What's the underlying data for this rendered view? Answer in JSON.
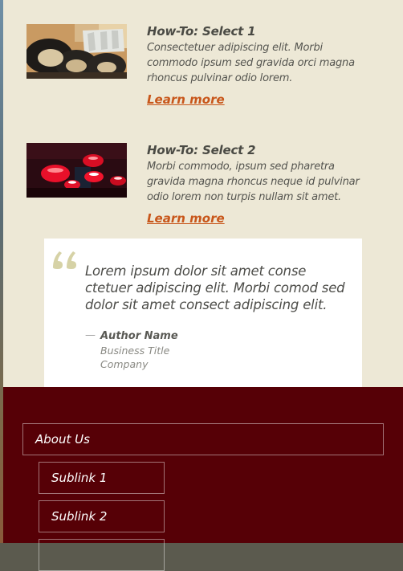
{
  "articles": [
    {
      "title": "How-To: Select 1",
      "description": "Consectetuer adipiscing elit. Morbi commodo ipsum sed gravida orci magna rhoncus pulvinar odio lorem.",
      "link_label": "Learn more"
    },
    {
      "title": "How-To: Select 2",
      "description": "Morbi commodo, ipsum sed pharetra gravida magna rhoncus neque id pulvinar odio lorem non turpis nullam sit amet.",
      "link_label": "Learn more"
    }
  ],
  "testimonial": {
    "quote": "Lorem ipsum dolor sit amet conse ctetuer adipiscing elit. Morbi comod sed dolor sit amet consect adipiscing elit.",
    "dash": "—",
    "author": "Author Name",
    "title": "Business Title",
    "company": "Company"
  },
  "footer_nav": {
    "main_label": "About Us",
    "sublinks": [
      "Sublink 1",
      "Sublink 2"
    ]
  },
  "colors": {
    "content_bg": "#ede8d6",
    "link": "#c8561a",
    "footer_bg": "#560006",
    "quote_mark": "#d6d2a6"
  }
}
